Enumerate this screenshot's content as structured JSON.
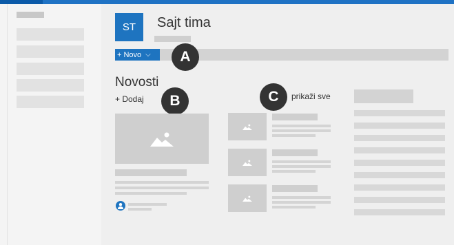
{
  "site": {
    "logo_initials": "ST",
    "title": "Sajt tima"
  },
  "commandbar": {
    "new_label": "+ Novo",
    "new_chevron": "⌵"
  },
  "news": {
    "title": "Novosti",
    "add_label": "+ Dodaj",
    "see_all_label": "prikaži sve"
  },
  "callouts": {
    "a": "A",
    "b": "B",
    "c": "C"
  },
  "colors": {
    "accent": "#1e74c0",
    "topbar": "#1f72c4",
    "callout": "#333333"
  },
  "icons": {
    "image": "image-placeholder-icon",
    "user": "person-icon"
  }
}
